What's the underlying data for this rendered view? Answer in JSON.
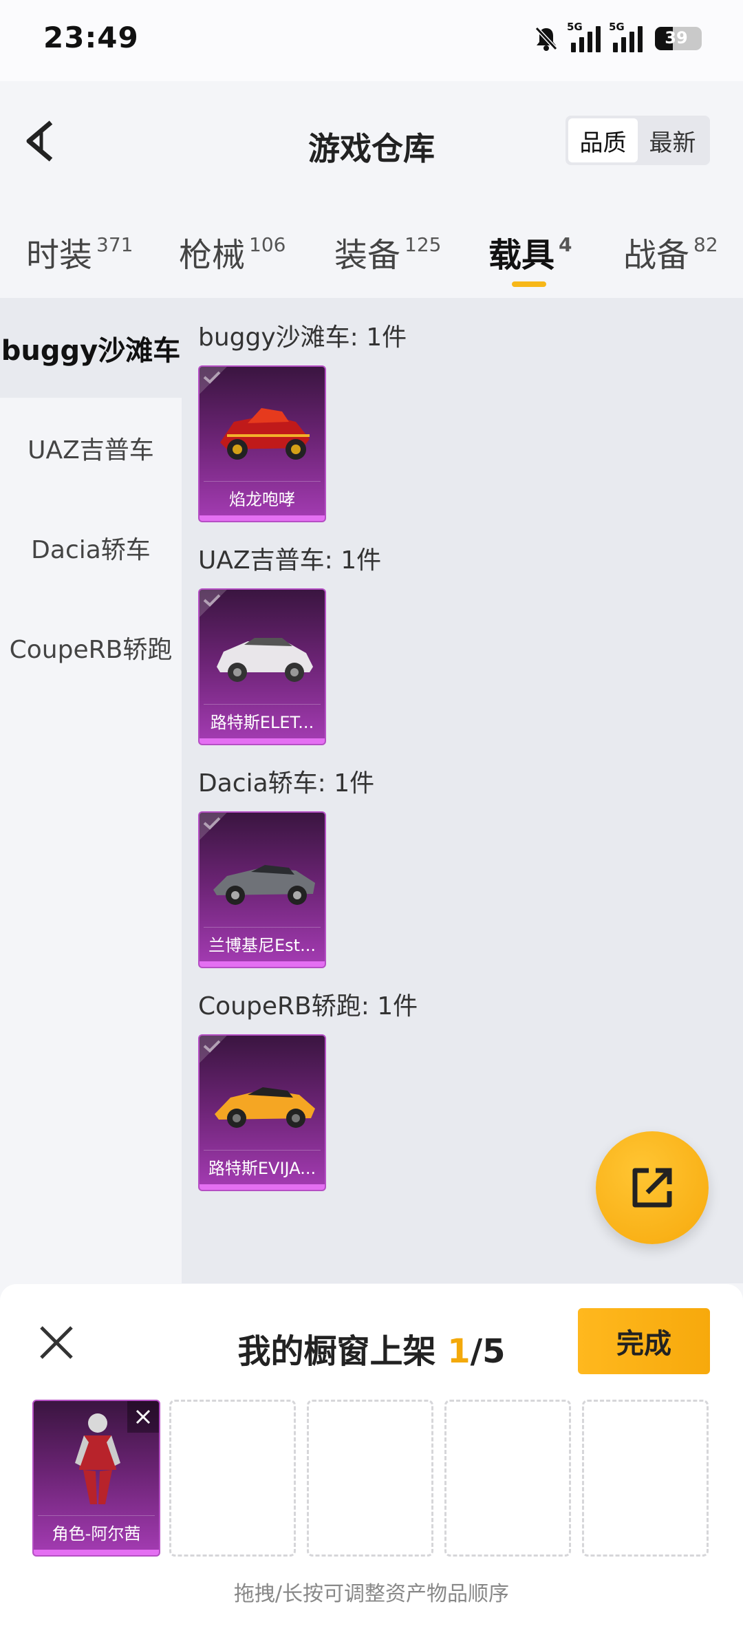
{
  "status": {
    "time": "23:49",
    "battery": "39",
    "net1": "5G",
    "net2": "5G"
  },
  "header": {
    "title": "游戏仓库",
    "sort": [
      "品质",
      "最新"
    ]
  },
  "tabs": [
    {
      "label": "时装",
      "count": "371"
    },
    {
      "label": "枪械",
      "count": "106"
    },
    {
      "label": "装备",
      "count": "125"
    },
    {
      "label": "载具",
      "count": "4"
    },
    {
      "label": "战备",
      "count": "82"
    }
  ],
  "side": [
    "buggy沙滩车",
    "UAZ吉普车",
    "Dacia轿车",
    "CoupeRB轿跑"
  ],
  "groups": [
    {
      "title": "buggy沙滩车: 1件",
      "item": "焰龙咆哮",
      "icon": "red-buggy-icon"
    },
    {
      "title": "UAZ吉普车: 1件",
      "item": "路特斯ELET...",
      "icon": "white-suv-icon"
    },
    {
      "title": "Dacia轿车: 1件",
      "item": "兰博基尼Est...",
      "icon": "grey-sports-car-icon"
    },
    {
      "title": "CoupeRB轿跑: 1件",
      "item": "路特斯EVIJA...",
      "icon": "yellow-sports-car-icon"
    }
  ],
  "panel": {
    "title_prefix": "我的橱窗上架 ",
    "current": "1",
    "total": "/5",
    "done": "完成",
    "slot1": "角色-阿尔茜",
    "hint": "拖拽/长按可调整资产物品顺序"
  }
}
